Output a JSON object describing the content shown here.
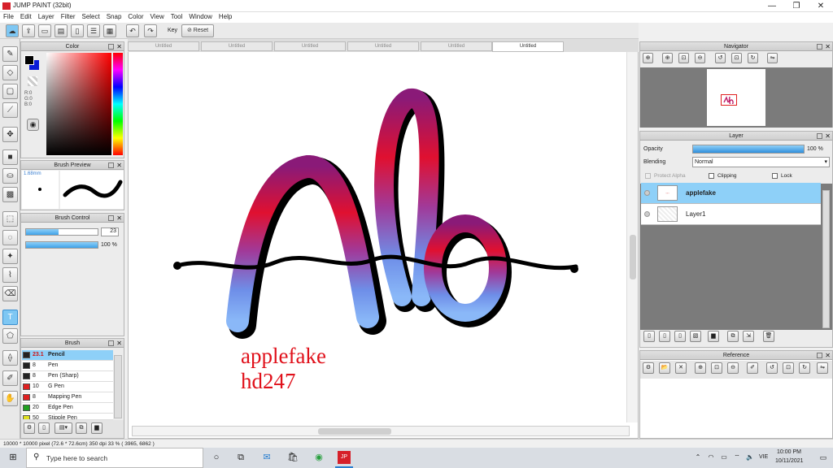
{
  "app": {
    "title": "JUMP PAINT (32bit)"
  },
  "menu": [
    "File",
    "Edit",
    "Layer",
    "Filter",
    "Select",
    "Snap",
    "Color",
    "View",
    "Tool",
    "Window",
    "Help"
  ],
  "toolbar": {
    "key_label": "Key",
    "reset_label": "Reset"
  },
  "color_panel": {
    "title": "Color",
    "r": "R:0",
    "g": "G:0",
    "b": "B:0"
  },
  "brush_preview": {
    "title": "Brush Preview",
    "size": "1.68mm"
  },
  "brush_control": {
    "title": "Brush Control",
    "size_value": "23",
    "size_fraction": 0.45,
    "opacity_value": "100 %",
    "opacity_fraction": 1.0
  },
  "brush_panel": {
    "title": "Brush",
    "items": [
      {
        "size": "23.1",
        "name": "Pencil",
        "color": "#222222"
      },
      {
        "size": "8",
        "name": "Pen",
        "color": "#222222"
      },
      {
        "size": "8",
        "name": "Pen (Sharp)",
        "color": "#222222"
      },
      {
        "size": "10",
        "name": "G Pen",
        "color": "#e02020"
      },
      {
        "size": "8",
        "name": "Mapping Pen",
        "color": "#e02020"
      },
      {
        "size": "20",
        "name": "Edge Pen",
        "color": "#20a020"
      },
      {
        "size": "50",
        "name": "Stipple Pen",
        "color": "#e0e020"
      }
    ]
  },
  "tabs": [
    "Untitled",
    "Untitled",
    "Untitled",
    "Untitled",
    "Untitled",
    "Untitled"
  ],
  "canvas": {
    "text_line1": "applefake",
    "text_line2": "hd247",
    "text_color": "#e0101a"
  },
  "navigator": {
    "title": "Navigator"
  },
  "layer_panel": {
    "title": "Layer",
    "opacity_label": "Opacity",
    "opacity_value": "100 %",
    "opacity_fraction": 1.0,
    "blending_label": "Blending",
    "blending_value": "Normal",
    "protect_alpha": "Protect Alpha",
    "clipping": "Clipping",
    "lock": "Lock",
    "layers": [
      {
        "name": "applefake",
        "selected": true
      },
      {
        "name": "Layer1",
        "selected": false
      }
    ]
  },
  "reference": {
    "title": "Reference"
  },
  "status": {
    "text": "10000 * 10000 pixel   (72.6 * 72.6cm)   350 dpi   33 %   ( 3965, 6862 )"
  },
  "taskbar": {
    "search_placeholder": "Type here to search",
    "lang": "VIE",
    "time": "10:00 PM",
    "date": "10/11/2021"
  },
  "colors": {
    "accent": "#7ec7f3",
    "selection_blue": "#2f8fdc"
  }
}
